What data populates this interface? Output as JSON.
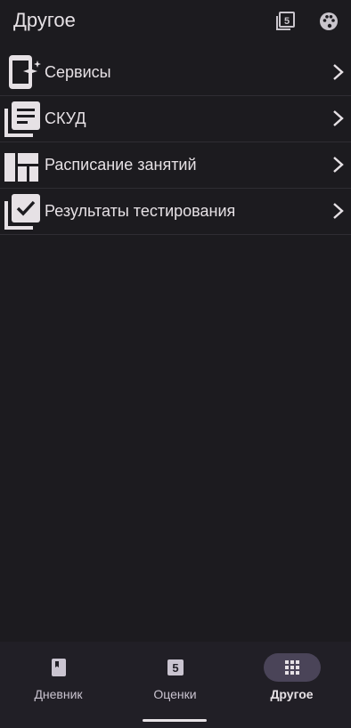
{
  "app": {
    "title": "Другое"
  },
  "header": {
    "icons": [
      "marks-five-icon",
      "palette-icon"
    ]
  },
  "menu": {
    "items": [
      {
        "label": "Сервисы",
        "icon": "mobile-sparkle-icon"
      },
      {
        "label": "СКУД",
        "icon": "library-books-icon"
      },
      {
        "label": "Расписание занятий",
        "icon": "dashboard-grid-icon"
      },
      {
        "label": "Результаты тестирования",
        "icon": "library-check-icon"
      }
    ]
  },
  "bottom_nav": {
    "items": [
      {
        "label": "Дневник",
        "icon": "book-icon",
        "active": false
      },
      {
        "label": "Оценки",
        "icon": "grade-five-icon",
        "active": false
      },
      {
        "label": "Другое",
        "icon": "apps-grid-icon",
        "active": true
      }
    ]
  },
  "colors": {
    "background": "#1c1b1f",
    "text": "#e6e1e5",
    "nav_background": "#211f26",
    "active_pill": "#4a4458"
  }
}
